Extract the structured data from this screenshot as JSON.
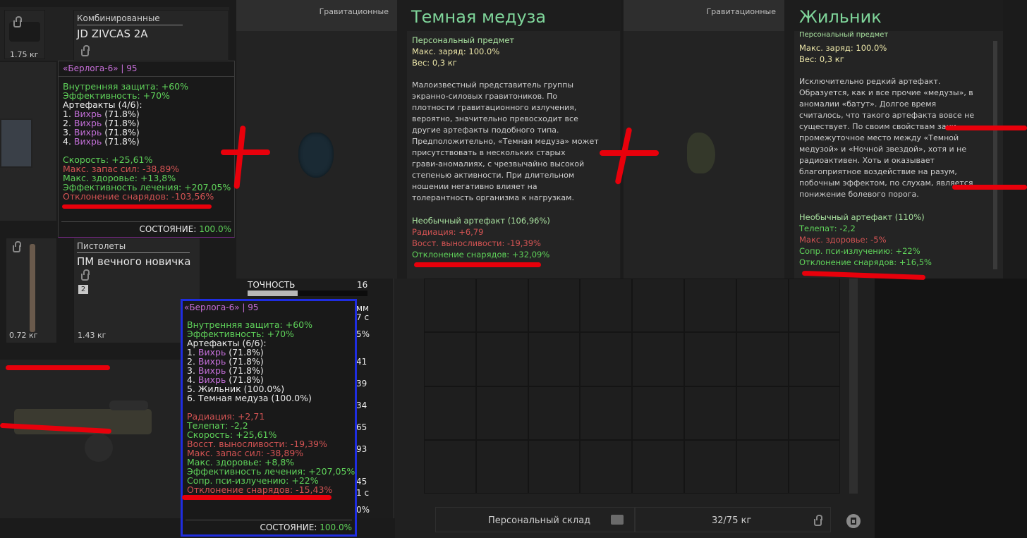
{
  "weapon_slot_top": {
    "category": "Комбинированные",
    "name": "JD ZIVCAS 2A",
    "weight": "1.75 кг"
  },
  "weapon_slot_mid": {
    "category": "Пистолеты",
    "name": "ПМ вечного новичка",
    "badge": "2",
    "weight_left": "0.72 кг",
    "weight_right": "1.43 кг"
  },
  "armor_tooltip_before": {
    "header": "«Берлога-6» | 95",
    "lines": [
      {
        "t": "Внутренняя защита: +60%",
        "c": "g"
      },
      {
        "t": "Эффективность: +70%",
        "c": "g"
      },
      {
        "t": "Артефакты (4/6):",
        "c": "w"
      },
      {
        "t": "1. Вихрь (71.8%)",
        "c": "w"
      },
      {
        "t": "2. Вихрь (71.8%)",
        "c": "w"
      },
      {
        "t": "3. Вихрь (71.8%)",
        "c": "w"
      },
      {
        "t": "4. Вихрь (71.8%)",
        "c": "w"
      },
      {
        "t": "",
        "c": "w"
      },
      {
        "t": "Скорость: +25,61%",
        "c": "g"
      },
      {
        "t": "Макс. запас сил: -38,89%",
        "c": "r"
      },
      {
        "t": "Макс. здоровье: +13,8%",
        "c": "g"
      },
      {
        "t": "Эффективность лечения: +207,05%",
        "c": "g"
      },
      {
        "t": "Отклонение снарядов: -103,56%",
        "c": "r"
      }
    ],
    "state_label": "СОСТОЯНИЕ:",
    "state_value": "100.0%"
  },
  "artifact_medusa": {
    "category": "Гравитационные",
    "title": "Темная медуза",
    "personal": "Персональный предмет",
    "charge": "Макс. заряд: 100.0%",
    "weight": "Вес: 0,3 кг",
    "description": [
      "Малоизвестный представитель группы",
      "экранно-силовых гравитоников. По",
      "плотности гравитационного излучения,",
      "вероятно, значительно превосходит все",
      "другие артефакты подобного типа.",
      "Предположительно, «Темная медуза» может",
      "присутствовать в нескольких старых",
      "грави-аномалиях, с чрезвычайно высокой",
      "степенью активности. При длительном",
      "ношении негативно влияет на",
      "толерантность организма к нагрузкам."
    ],
    "rarity": "Необычный артефакт (106,96%)",
    "stats": [
      {
        "t": "Радиация: +6,79",
        "c": "r"
      },
      {
        "t": "Восст. выносливости: -19,39%",
        "c": "r"
      },
      {
        "t": "Отклонение снарядов: +32,09%",
        "c": "g"
      }
    ]
  },
  "artifact_zhilnik": {
    "category": "Гравитационные",
    "title": "Жильник",
    "personal": "Персональный предмет",
    "charge": "Макс. заряд: 100.0%",
    "weight": "Вес: 0,3 кг",
    "description": [
      "Исключительно редкий артефакт.",
      "Образуется, как и все прочие «медузы», в",
      "аномалии «батут». Долгое время",
      "считалось, что такого артефакта вовсе не",
      "существует. По своим свойствам зани",
      "промежуточное место между «Темной",
      "медузой» и «Ночной звездой», хотя и не",
      "радиоактивен. Хоть и оказывает",
      "благоприятное воздействие на разум,",
      "побочным эффектом, по слухам, является",
      "понижение болевого порога."
    ],
    "rarity": "Необычный артефакт (110%)",
    "stats": [
      {
        "t": "Телепат: -2,2",
        "c": "g"
      },
      {
        "t": "Макс. здоровье: -5%",
        "c": "r"
      },
      {
        "t": "Сопр. пси-излучению: +22%",
        "c": "g"
      },
      {
        "t": "Отклонение снарядов: +16,5%",
        "c": "g"
      }
    ]
  },
  "armor_tooltip_after": {
    "header": "«Берлога-6» | 95",
    "lines": [
      {
        "t": "Внутренняя защита: +60%",
        "c": "g"
      },
      {
        "t": "Эффективность: +70%",
        "c": "g"
      },
      {
        "t": "Артефакты (6/6):",
        "c": "w"
      },
      {
        "t": "1. Вихрь (71.8%)",
        "c": "w"
      },
      {
        "t": "2. Вихрь (71.8%)",
        "c": "w"
      },
      {
        "t": "3. Вихрь (71.8%)",
        "c": "w"
      },
      {
        "t": "4. Вихрь (71.8%)",
        "c": "w"
      },
      {
        "t": "5. Жильник (100.0%)",
        "c": "w"
      },
      {
        "t": "6. Темная медуза (100.0%)",
        "c": "w"
      },
      {
        "t": "",
        "c": "w"
      },
      {
        "t": "Радиация: +2,71",
        "c": "r"
      },
      {
        "t": "Телепат: -2,2",
        "c": "g"
      },
      {
        "t": "Скорость: +25,61%",
        "c": "g"
      },
      {
        "t": "Восст. выносливости: -19,39%",
        "c": "r"
      },
      {
        "t": "Макс. запас сил: -38,89%",
        "c": "r"
      },
      {
        "t": "Макс. здоровье: +8,8%",
        "c": "g"
      },
      {
        "t": "Эффективность лечения: +207,05%",
        "c": "g"
      },
      {
        "t": "Сопр. пси-излучению: +22%",
        "c": "g"
      },
      {
        "t": "Отклонение снарядов: -15,43%",
        "c": "r"
      }
    ],
    "state_label": "СОСТОЯНИЕ:",
    "state_value": "100.0%"
  },
  "weapon_stats": {
    "accuracy_label": "ТОЧНОСТЬ",
    "accuracy_value": "16",
    "accuracy_fraction": 0.42,
    "partials": [
      "мм",
      "7 с",
      "5%",
      "41",
      "39",
      "34",
      "65",
      "93",
      "45",
      "1 с",
      "0%"
    ]
  },
  "storage": {
    "label": "Персональный склад",
    "weight": "32/75 кг"
  },
  "colors": {
    "green": "#5fd35a",
    "red": "#d35353",
    "purple": "#c46fd9",
    "title_green": "#7fd59a",
    "annotation": "#e8000b",
    "highlight": "#1f2de0"
  }
}
